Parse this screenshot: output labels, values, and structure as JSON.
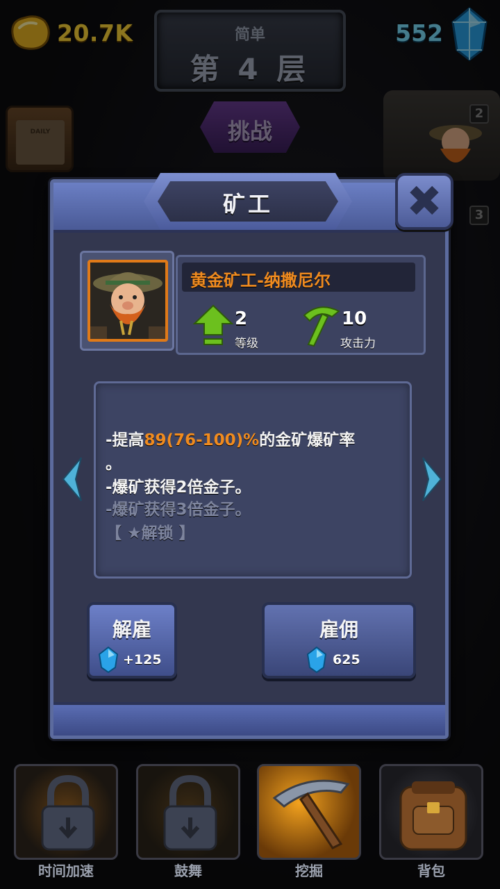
{
  "currency": {
    "gold": "20.7K",
    "gems": "552"
  },
  "level": {
    "difficulty": "简单",
    "floor": "第 4 层"
  },
  "challenge_label": "挑战",
  "calendar_label": "DAILY",
  "side_badges": [
    "2",
    "3"
  ],
  "modal": {
    "title": "矿工",
    "close_glyph": "✖",
    "miner_name": "黄金矿工-纳撒尼尔",
    "stats": {
      "level_value": "2",
      "level_label": "等级",
      "attack_value": "10",
      "attack_label": "攻击力"
    },
    "skills": {
      "line1_prefix": "-提高",
      "line1_highlight": "89(76-100)%",
      "line1_suffix": "的金矿爆矿率",
      "line1_wrap": "。",
      "line2": "-爆矿获得2倍金子。",
      "line3_locked": "-爆矿获得3倍金子。",
      "line4_locked": "【 ★解锁 】"
    },
    "dismiss": {
      "label": "解雇",
      "refund": "+125"
    },
    "hire": {
      "label": "雇佣",
      "cost": "625"
    }
  },
  "dock": [
    {
      "label": "时间加速",
      "icon": "lock-icon",
      "locked": true
    },
    {
      "label": "鼓舞",
      "icon": "lock-icon",
      "locked": true
    },
    {
      "label": "挖掘",
      "icon": "pickaxe-icon",
      "locked": false
    },
    {
      "label": "背包",
      "icon": "backpack-icon",
      "locked": false
    }
  ],
  "colors": {
    "gold_text": "#ffd83a",
    "gem_text": "#7fe2ff",
    "highlight_orange": "#f08b1f",
    "level_up_green": "#6cc01e",
    "panel_blue": "#5c6b9e"
  }
}
